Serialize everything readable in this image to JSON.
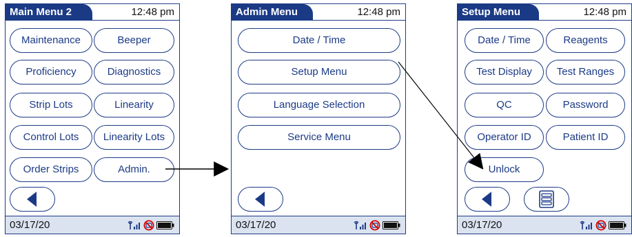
{
  "screens": [
    {
      "title": "Main Menu 2",
      "time": "12:48 pm",
      "date": "03/17/20",
      "buttons": [
        "Maintenance",
        "Beeper",
        "Proficiency",
        "Diagnostics",
        "Strip Lots",
        "Linearity",
        "Control Lots",
        "Linearity Lots",
        "Order Strips",
        "Admin."
      ]
    },
    {
      "title": "Admin Menu",
      "time": "12:48 pm",
      "date": "03/17/20",
      "buttons": [
        "Date / Time",
        "Setup Menu",
        "Language Selection",
        "Service Menu"
      ]
    },
    {
      "title": "Setup Menu",
      "time": "12:48 pm",
      "date": "03/17/20",
      "buttons": [
        "Date / Time",
        "Reagents",
        "Test Display",
        "Test Ranges",
        "QC",
        "Password",
        "Operator ID",
        "Patient ID",
        "Unlock"
      ]
    }
  ],
  "icons": {
    "back": "back-arrow-icon",
    "signal": "signal-antenna-icon",
    "no_connection": "no-connection-icon",
    "battery": "battery-icon",
    "layout": "list-layout-icon"
  },
  "colors": {
    "brand": "#1b3a86",
    "status_bar": "#dbe3f0",
    "warning": "#d40000"
  }
}
